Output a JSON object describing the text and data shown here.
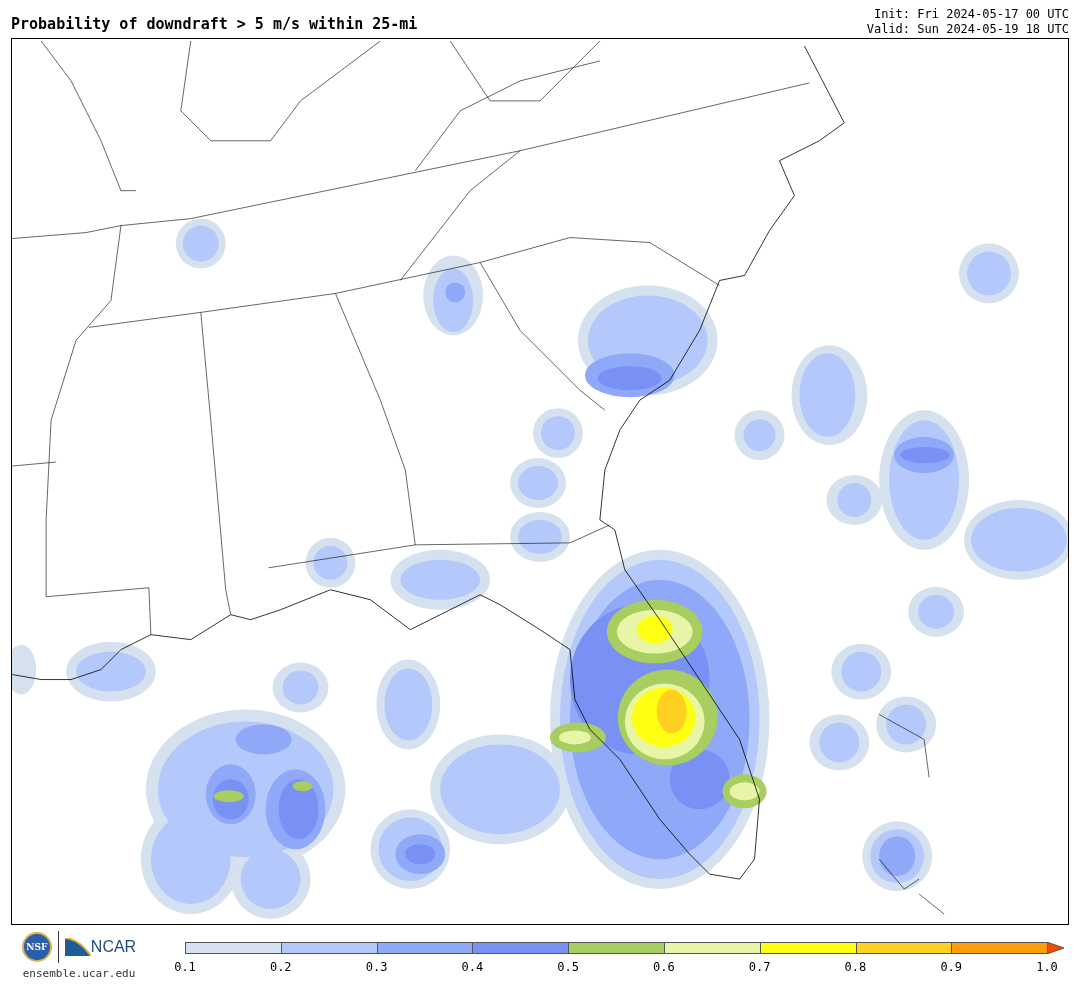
{
  "title": "Probability of downdraft > 5 m/s within 25-mi",
  "init": "Init: Fri 2024-05-17 00 UTC",
  "valid": "Valid: Sun 2024-05-19 18 UTC",
  "footer": {
    "seal_text": "NSF",
    "logo_text": "NCAR",
    "url": "ensemble.ucar.edu"
  },
  "colorbar": {
    "bins": [
      {
        "color": "#d5e1ee"
      },
      {
        "color": "#b4c8fb"
      },
      {
        "color": "#8fa8f8"
      },
      {
        "color": "#7990f4"
      },
      {
        "color": "#a8cd60"
      },
      {
        "color": "#e6f5a6"
      },
      {
        "color": "#ffff14"
      },
      {
        "color": "#ffd020"
      },
      {
        "color": "#ff9e0a"
      },
      {
        "color": "#f04a00",
        "kind": "arrow"
      }
    ],
    "ticks": [
      "0.1",
      "0.2",
      "0.3",
      "0.4",
      "0.5",
      "0.6",
      "0.7",
      "0.8",
      "0.9",
      "1.0"
    ]
  }
}
